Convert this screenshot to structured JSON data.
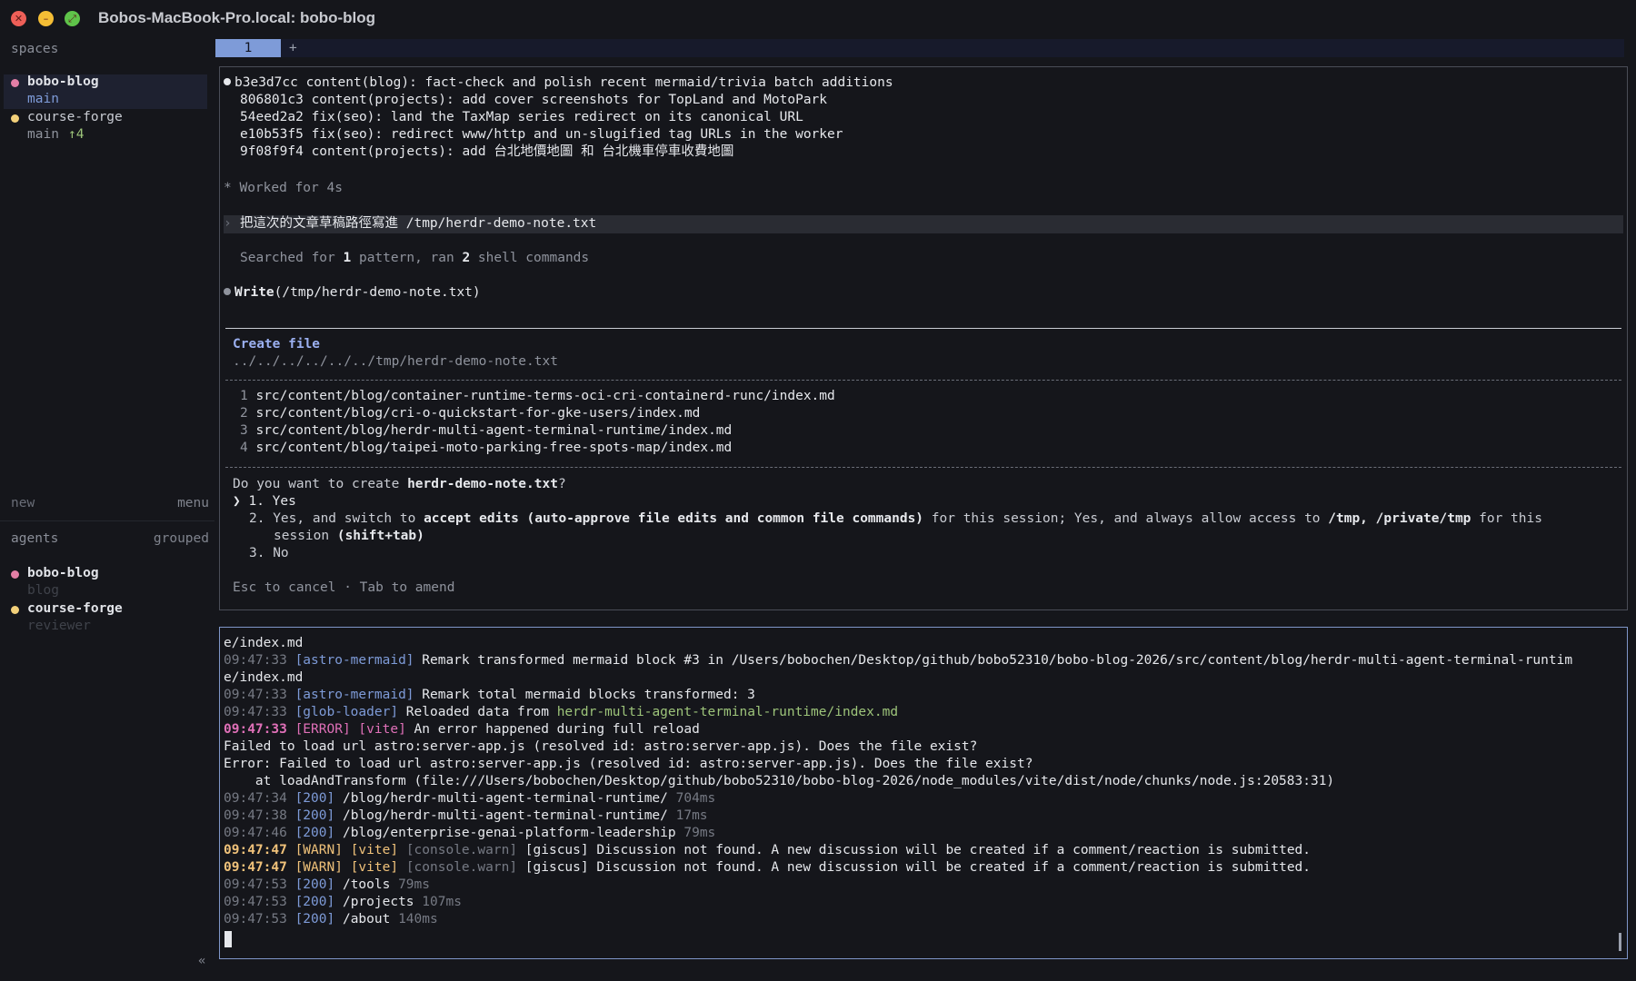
{
  "window": {
    "title": "Bobos-MacBook-Pro.local: bobo-blog"
  },
  "sidebar": {
    "spaces_label": "spaces",
    "spaces": [
      {
        "name": "bobo-blog",
        "branch": "main",
        "dot_color": "#e37fa6"
      },
      {
        "name": "course-forge",
        "branch": "main",
        "ahead": "↑4",
        "dot_color": "#f2d07a"
      }
    ],
    "new_label": "new",
    "menu_label": "menu",
    "agents_label": "agents",
    "grouped_label": "grouped",
    "agents": [
      {
        "name": "bobo-blog",
        "role": "blog",
        "dot_color": "#e37fa6"
      },
      {
        "name": "course-forge",
        "role": "reviewer",
        "dot_color": "#f2d07a"
      }
    ],
    "collapse_glyph": "«"
  },
  "tabs": {
    "active": "1",
    "add": "+"
  },
  "pane1": {
    "commits": [
      {
        "hash": "b3e3d7cc",
        "msg": "content(blog): fact-check and polish recent mermaid/trivia batch additions"
      },
      {
        "hash": "806801c3",
        "msg": "content(projects): add cover screenshots for TopLand and MotoPark"
      },
      {
        "hash": "54eed2a2",
        "msg": "fix(seo): land the TaxMap series redirect on its canonical URL"
      },
      {
        "hash": "e10b53f5",
        "msg": "fix(seo): redirect www/http and un-slugified tag URLs in the worker"
      },
      {
        "hash": "9f08f9f4",
        "msg": "content(projects): add 台北地價地圖 和 台北機車停車收費地圖"
      }
    ],
    "worked": "* Worked for 4s",
    "prompt_glyph": "›",
    "prompt": "把這次的文章草稿路徑寫進 /tmp/herdr-demo-note.txt",
    "search_pre": "Searched for ",
    "search_n1": "1",
    "search_mid": " pattern, ran ",
    "search_n2": "2",
    "search_post": " shell commands",
    "write_tool": "Write",
    "write_arg": "(/tmp/herdr-demo-note.txt)",
    "create_title": "Create file",
    "create_path": "../../../../../../tmp/herdr-demo-note.txt",
    "file_lines": [
      {
        "n": "1",
        "text": "src/content/blog/container-runtime-terms-oci-cri-containerd-runc/index.md"
      },
      {
        "n": "2",
        "text": "src/content/blog/cri-o-quickstart-for-gke-users/index.md"
      },
      {
        "n": "3",
        "text": "src/content/blog/herdr-multi-agent-terminal-runtime/index.md"
      },
      {
        "n": "4",
        "text": "src/content/blog/taipei-moto-parking-free-spots-map/index.md"
      }
    ],
    "question_pre": "Do you want to create ",
    "question_file": "herdr-demo-note.txt",
    "question_post": "?",
    "opt1_glyph": "❯",
    "opt1": "1. Yes",
    "opt2_a": "2. Yes, and switch to ",
    "opt2_b": "accept edits (auto-approve file edits and common file commands)",
    "opt2_c": " for this session; Yes, and always allow access to ",
    "opt2_d": "/tmp, /private/tmp",
    "opt2_e": " for this",
    "opt2_f": "session",
    "opt2_g": " (shift+tab)",
    "opt3": "3. No",
    "hint": "Esc to cancel · Tab to amend"
  },
  "pane2": {
    "l1": "e/index.md",
    "l2_time": "09:47:33",
    "l2_tag": "[astro-mermaid]",
    "l2_msg": " Remark transformed mermaid block #3 in /Users/bobochen/Desktop/github/bobo52310/bobo-blog-2026/src/content/blog/herdr-multi-agent-terminal-runtim",
    "l3": "e/index.md",
    "l4_time": "09:47:33",
    "l4_tag": "[astro-mermaid]",
    "l4_msg": " Remark total mermaid blocks transformed: 3",
    "l5_time": "09:47:33",
    "l5_tag": "[glob-loader]",
    "l5_msg": " Reloaded data from ",
    "l5_path": "herdr-multi-agent-terminal-runtime/index.md",
    "l6_time": "09:47:33",
    "l6_err": "[ERROR]",
    "l6_vite": "[vite]",
    "l6_msg": " An error happened during full reload",
    "l7": "Failed to load url astro:server-app.js (resolved id: astro:server-app.js). Does the file exist?",
    "l8": "Error: Failed to load url astro:server-app.js (resolved id: astro:server-app.js). Does the file exist?",
    "l9": "    at loadAndTransform (file:///Users/bobochen/Desktop/github/bobo52310/bobo-blog-2026/node_modules/vite/dist/node/chunks/node.js:20583:31)",
    "requests1": [
      {
        "time": "09:47:34",
        "code": "[200]",
        "path": " /blog/herdr-multi-agent-terminal-runtime/",
        "dur": " 704ms"
      },
      {
        "time": "09:47:38",
        "code": "[200]",
        "path": " /blog/herdr-multi-agent-terminal-runtime/",
        "dur": " 17ms"
      },
      {
        "time": "09:47:46",
        "code": "[200]",
        "path": " /blog/enterprise-genai-platform-leadership",
        "dur": " 79ms"
      }
    ],
    "warns": [
      {
        "time": "09:47:47",
        "warn": "[WARN]",
        "vite": "[vite]",
        "cw": "[console.warn]",
        "msg": " [giscus] Discussion not found. A new discussion will be created if a comment/reaction is submitted."
      },
      {
        "time": "09:47:47",
        "warn": "[WARN]",
        "vite": "[vite]",
        "cw": "[console.warn]",
        "msg": " [giscus] Discussion not found. A new discussion will be created if a comment/reaction is submitted."
      }
    ],
    "requests2": [
      {
        "time": "09:47:53",
        "code": "[200]",
        "path": " /tools",
        "dur": " 79ms"
      },
      {
        "time": "09:47:53",
        "code": "[200]",
        "path": " /projects",
        "dur": " 107ms"
      },
      {
        "time": "09:47:53",
        "code": "[200]",
        "path": " /about",
        "dur": " 140ms"
      }
    ]
  }
}
